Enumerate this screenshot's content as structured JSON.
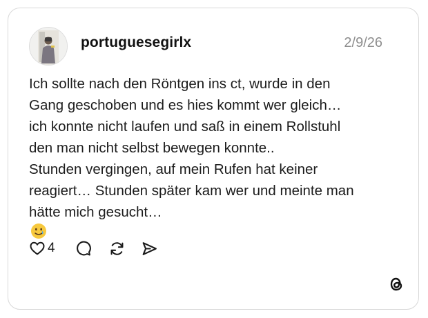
{
  "post": {
    "username": "portuguesegirlx",
    "date": "2/9/26",
    "lines": [
      "Ich sollte nach den Röntgen ins ct, wurde in den",
      "Gang geschoben und es hies kommt wer gleich…",
      "ich konnte nicht laufen und saß in einem Rollstuhl",
      "den man nicht selbst bewegen konnte..",
      "Stunden vergingen, auf mein Rufen hat keiner",
      "reagiert… Stunden später kam wer und meinte man",
      "hätte mich gesucht… "
    ],
    "emoji": "smiling-face-with-tear-emoji"
  },
  "actions": {
    "like_count": "4",
    "like_icon": "heart-icon",
    "reply_icon": "comment-icon",
    "repost_icon": "repost-icon",
    "share_icon": "send-icon"
  },
  "brand": {
    "logo": "threads-logo-icon"
  },
  "colors": {
    "border": "#d8d8d8",
    "muted": "#8e8e8e",
    "text": "#1c1c1c"
  }
}
